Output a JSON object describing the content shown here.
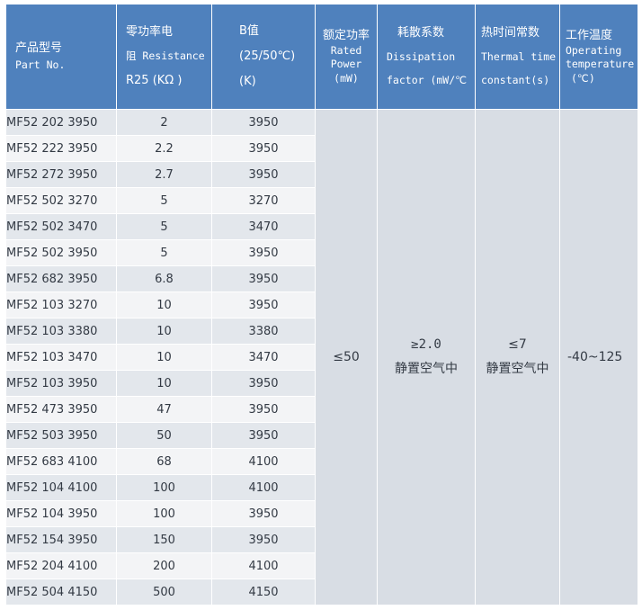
{
  "headers": {
    "part": {
      "cn": "产品型号",
      "en": "Part No."
    },
    "resistance": {
      "l1": "零功率电",
      "l2": "阻 Resistance",
      "l3": "R25 (KΩ )"
    },
    "bvalue": {
      "l1": "B值",
      "l2": "(25/50℃)",
      "l3": "(K)"
    },
    "rated_power": {
      "l1": "额定功率",
      "l2": "Rated",
      "l3": "Power",
      "l4": "(mW)"
    },
    "dissipation": {
      "l1": "耗散系数",
      "l2": "Dissipation",
      "l3": "factor (mW/℃"
    },
    "thermal": {
      "l1": "热时间常数",
      "l2": "Thermal time",
      "l3": "constant(s)"
    },
    "operating": {
      "l1": "工作温度",
      "l2": "Operating",
      "l3": "temperature",
      "l4": "(℃)"
    }
  },
  "rows": [
    {
      "part": "MF52 202 3950",
      "r25": "2",
      "b": "3950"
    },
    {
      "part": "MF52 222 3950",
      "r25": "2.2",
      "b": "3950"
    },
    {
      "part": "MF52 272 3950",
      "r25": "2.7",
      "b": "3950"
    },
    {
      "part": "MF52 502 3270",
      "r25": "5",
      "b": "3270"
    },
    {
      "part": "MF52 502 3470",
      "r25": "5",
      "b": "3470"
    },
    {
      "part": "MF52 502 3950",
      "r25": "5",
      "b": "3950"
    },
    {
      "part": "MF52 682 3950",
      "r25": "6.8",
      "b": "3950"
    },
    {
      "part": "MF52 103 3270",
      "r25": "10",
      "b": "3950"
    },
    {
      "part": "MF52 103 3380",
      "r25": "10",
      "b": "3380"
    },
    {
      "part": "MF52 103 3470",
      "r25": "10",
      "b": "3470"
    },
    {
      "part": "MF52 103 3950",
      "r25": "10",
      "b": "3950"
    },
    {
      "part": "MF52 473 3950",
      "r25": "47",
      "b": "3950"
    },
    {
      "part": "MF52 503 3950",
      "r25": "50",
      "b": "3950"
    },
    {
      "part": "MF52 683 4100",
      "r25": "68",
      "b": "4100"
    },
    {
      "part": "MF52 104 4100",
      "r25": "100",
      "b": "4100"
    },
    {
      "part": "MF52 104 3950",
      "r25": "100",
      "b": "3950"
    },
    {
      "part": "MF52 154 3950",
      "r25": "150",
      "b": "3950"
    },
    {
      "part": "MF52 204 4100",
      "r25": "200",
      "b": "4100"
    },
    {
      "part": "MF52 504 4150",
      "r25": "500",
      "b": "4150"
    }
  ],
  "shared": {
    "rated_power": "≤50",
    "dissipation_value": "≥2.0",
    "dissipation_note": "静置空气中",
    "thermal_value": "≤7",
    "thermal_note": "静置空气中",
    "operating": "-40~125"
  }
}
